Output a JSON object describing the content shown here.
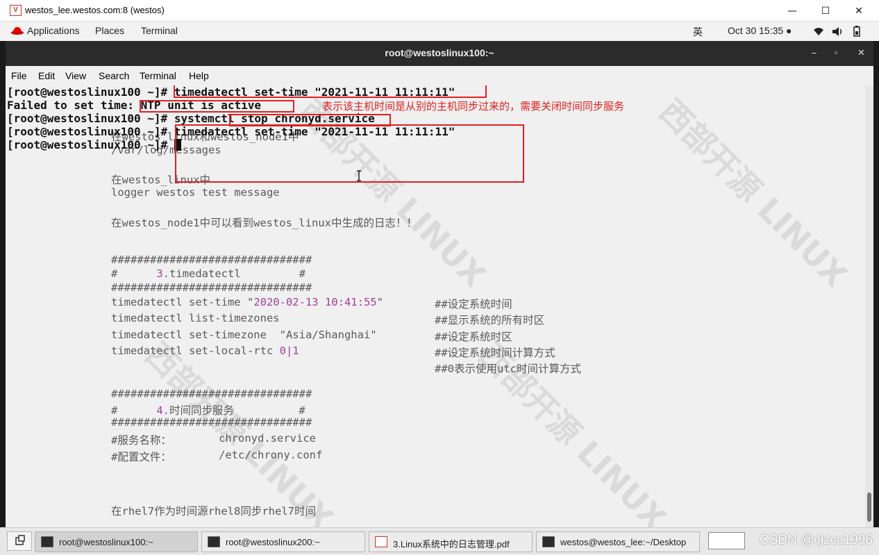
{
  "vm_window": {
    "icon_text": "V",
    "title": "westos_lee.westos.com:8 (westos)"
  },
  "gnome_bar": {
    "applications": "Applications",
    "places": "Places",
    "terminal": "Terminal",
    "input_method": "英",
    "clock": "Oct 30  15:35 ●"
  },
  "terminal": {
    "title": "root@westoslinux100:~",
    "menu": [
      "File",
      "Edit",
      "View",
      "Search",
      "Terminal",
      "Help"
    ],
    "lines": [
      "[root@westoslinux100 ~]# timedatectl set-time \"2021-11-11 11:11:11\"",
      "Failed to set time: NTP unit is active",
      "[root@westoslinux100 ~]# systemctl stop chronyd.service",
      "[root@westoslinux100 ~]# timedatectl set-time \"2021-11-11 11:11:11\"",
      "[root@westoslinux100 ~]# "
    ],
    "annotation": "表示该主机时间是从别的主机同步过来的，需要关闭时间同步服务"
  },
  "background_doc": {
    "l1": "在westos_linux和westos_node1中",
    "l2": "/var/log/messages",
    "l3": "在westos_linux中",
    "l4": "logger westos test message",
    "l5": "在westos_node1中可以看到westos_linux中生成的日志！！",
    "hash": "###############################",
    "sec3_prefix": "#      ",
    "sec3_num": "3.",
    "sec3_title": "timedatectl",
    "sec3_suffix": "         #",
    "c1": "timedatectl set-time \"",
    "c1_date": "2020-02-13 10:41:55",
    "c1_end": "\"",
    "c1_comment": "##设定系统时间",
    "c2": "timedatectl list-timezones",
    "c2_comment": "##显示系统的所有时区",
    "c3": "timedatectl set-timezone  \"Asia/Shanghai\"",
    "c3_comment": "##设定系统时区",
    "c4": "timedatectl set-local-rtc ",
    "c4_num": "0|1",
    "c4_comment": "##设定系统时间计算方式",
    "c5_comment": "##0表示使用utc时间计算方式",
    "sec4_prefix": "#      ",
    "sec4_num": "4.",
    "sec4_title": "时间同步服务",
    "sec4_suffix": "          #",
    "svc_label": "#服务名称：",
    "svc_value": "chronyd.service",
    "conf_label": "#配置文件：",
    "conf_value": "/etc/chrony.conf",
    "l_last": "在rhel7作为时间源rhel8同步rhel7时间"
  },
  "taskbar": {
    "items": [
      "root@westoslinux100:~",
      "root@westoslinux200:~",
      "3.Linux系统中的日志管理.pdf",
      "westos@westos_lee:~/Desktop"
    ],
    "watermark": "CSDN @cjzcc1996"
  },
  "colors": {
    "annotation_red": "#e02020",
    "terminal_bg": "#f0f0f0",
    "number_purple": "#a0409a"
  }
}
